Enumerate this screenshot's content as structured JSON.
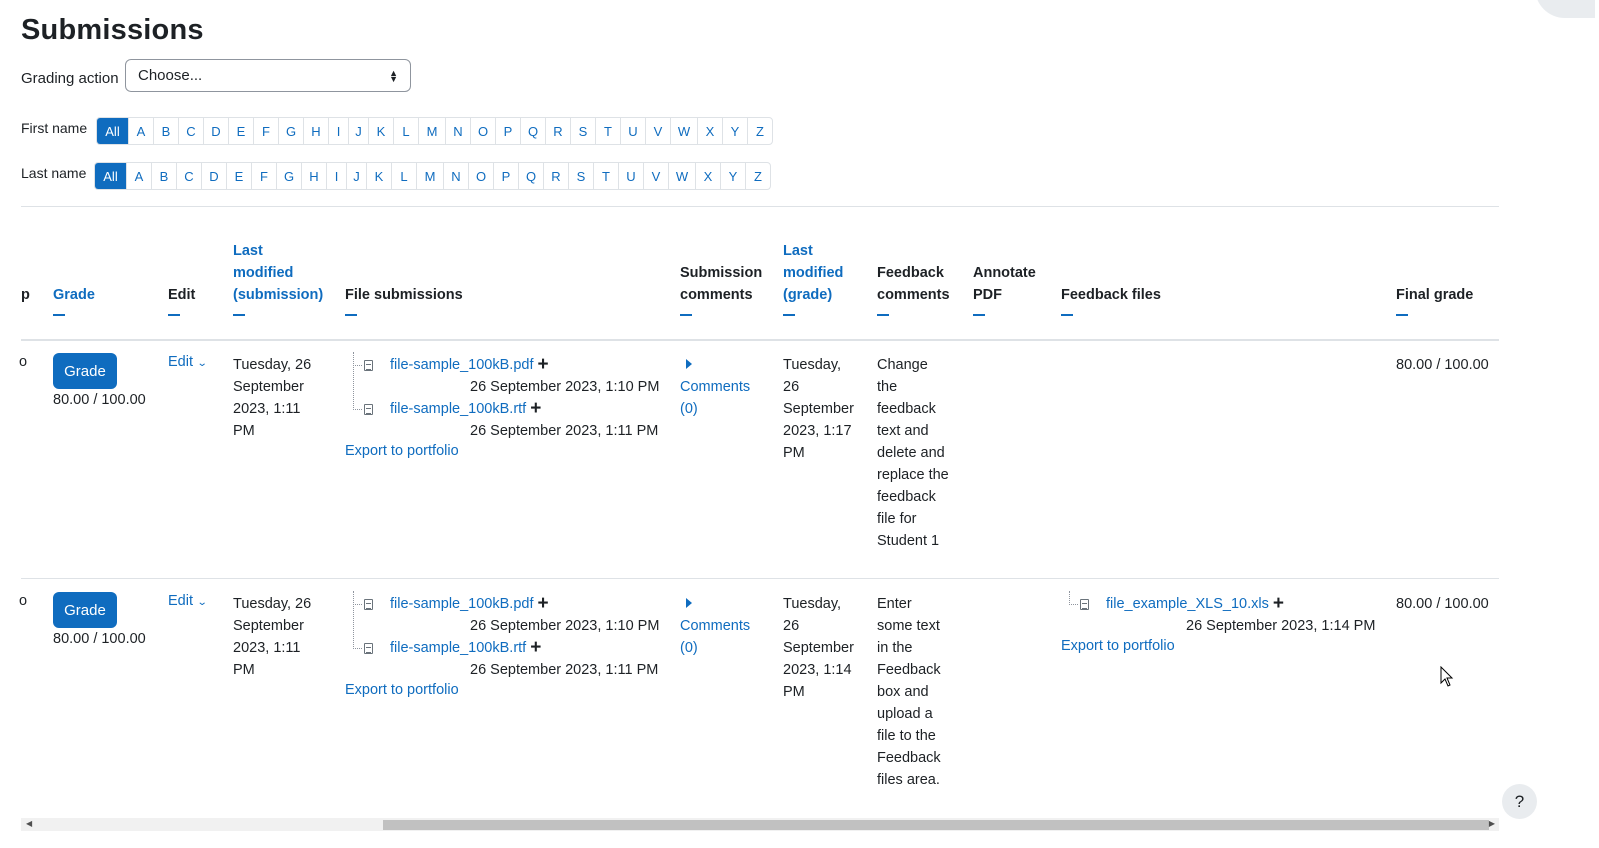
{
  "page": {
    "title": "Submissions",
    "grading_action_label": "Grading action",
    "grading_action_value": "Choose...",
    "help_label": "?"
  },
  "filters": {
    "first_name_label": "First name",
    "last_name_label": "Last name",
    "letters": [
      "All",
      "A",
      "B",
      "C",
      "D",
      "E",
      "F",
      "G",
      "H",
      "I",
      "J",
      "K",
      "L",
      "M",
      "N",
      "O",
      "P",
      "Q",
      "R",
      "S",
      "T",
      "U",
      "V",
      "W",
      "X",
      "Y",
      "Z"
    ],
    "selected": "All"
  },
  "table": {
    "partial_column_label": "p",
    "headers": {
      "grade": "Grade",
      "edit": "Edit",
      "last_modified_submission": [
        "Last",
        "modified",
        "(submission)"
      ],
      "file_submissions": "File submissions",
      "submission_comments": [
        "Submission",
        "comments"
      ],
      "last_modified_grade": [
        "Last",
        "modified",
        "(grade)"
      ],
      "feedback_comments": [
        "Feedback",
        "comments"
      ],
      "annotate_pdf": [
        "Annotate",
        "PDF"
      ],
      "feedback_files": "Feedback files",
      "final_grade": "Final grade"
    },
    "rows": [
      {
        "partial": "o",
        "grade_button": "Grade",
        "grade_value": "80.00 / 100.00",
        "edit_label": "Edit",
        "submission_modified": [
          "Tuesday, 26",
          "September",
          "2023, 1:11",
          "PM"
        ],
        "files": [
          {
            "name": "file-sample_100kB.pdf",
            "date": "26 September 2023, 1:10 PM"
          },
          {
            "name": "file-sample_100kB.rtf",
            "date": "26 September 2023, 1:11 PM"
          }
        ],
        "export_label": "Export to portfolio",
        "comments_label": [
          "Comments",
          "(0)"
        ],
        "grade_modified": [
          "Tuesday,",
          "26",
          "September",
          "2023, 1:17",
          "PM"
        ],
        "feedback": [
          "Change",
          "the",
          "feedback",
          "text and",
          "delete and",
          "replace the",
          "feedback",
          "file for",
          "Student 1"
        ],
        "feedback_files": [],
        "final_grade": "80.00 / 100.00"
      },
      {
        "partial": "o",
        "grade_button": "Grade",
        "grade_value": "80.00 / 100.00",
        "edit_label": "Edit",
        "submission_modified": [
          "Tuesday, 26",
          "September",
          "2023, 1:11",
          "PM"
        ],
        "files": [
          {
            "name": "file-sample_100kB.pdf",
            "date": "26 September 2023, 1:10 PM"
          },
          {
            "name": "file-sample_100kB.rtf",
            "date": "26 September 2023, 1:11 PM"
          }
        ],
        "export_label": "Export to portfolio",
        "comments_label": [
          "Comments",
          "(0)"
        ],
        "grade_modified": [
          "Tuesday,",
          "26",
          "September",
          "2023, 1:14",
          "PM"
        ],
        "feedback": [
          "Enter",
          "some text",
          "in the",
          "Feedback",
          "box and",
          "upload a",
          "file to the",
          "Feedback",
          "files area."
        ],
        "feedback_files": [
          {
            "name": "file_example_XLS_10.xls",
            "date": "26 September 2023, 1:14 PM"
          }
        ],
        "feedback_export_label": "Export to portfolio",
        "final_grade": "80.00 / 100.00"
      }
    ]
  }
}
